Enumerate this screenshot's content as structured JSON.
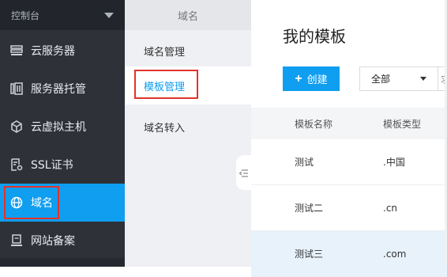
{
  "sidebar": {
    "header": "控制台",
    "items": [
      {
        "label": "云服务器",
        "icon": "server-icon"
      },
      {
        "label": "服务器托管",
        "icon": "hosting-icon"
      },
      {
        "label": "云虚拟主机",
        "icon": "cube-icon"
      },
      {
        "label": "SSL证书",
        "icon": "certificate-icon"
      },
      {
        "label": "域名",
        "icon": "globe-icon"
      },
      {
        "label": "网站备案",
        "icon": "record-icon"
      }
    ],
    "active_index": 4
  },
  "subnav": {
    "title": "域名",
    "items": [
      {
        "label": "域名管理"
      },
      {
        "label": "模板管理"
      },
      {
        "label": "域名转入"
      }
    ],
    "active_index": 1
  },
  "main": {
    "title": "我的模板",
    "create_label": "创建",
    "filter_value": "全部",
    "filter_next_fragment": "求",
    "columns": [
      "模板名称",
      "模板类型"
    ],
    "rows": [
      {
        "name": "测试",
        "type": ".中国"
      },
      {
        "name": "测试二",
        "type": ".cn"
      },
      {
        "name": "测试三",
        "type": ".com"
      }
    ]
  },
  "colors": {
    "accent": "#0f9ef0",
    "sidebar_bg": "#2e3238",
    "highlight_box": "#e2332b"
  }
}
